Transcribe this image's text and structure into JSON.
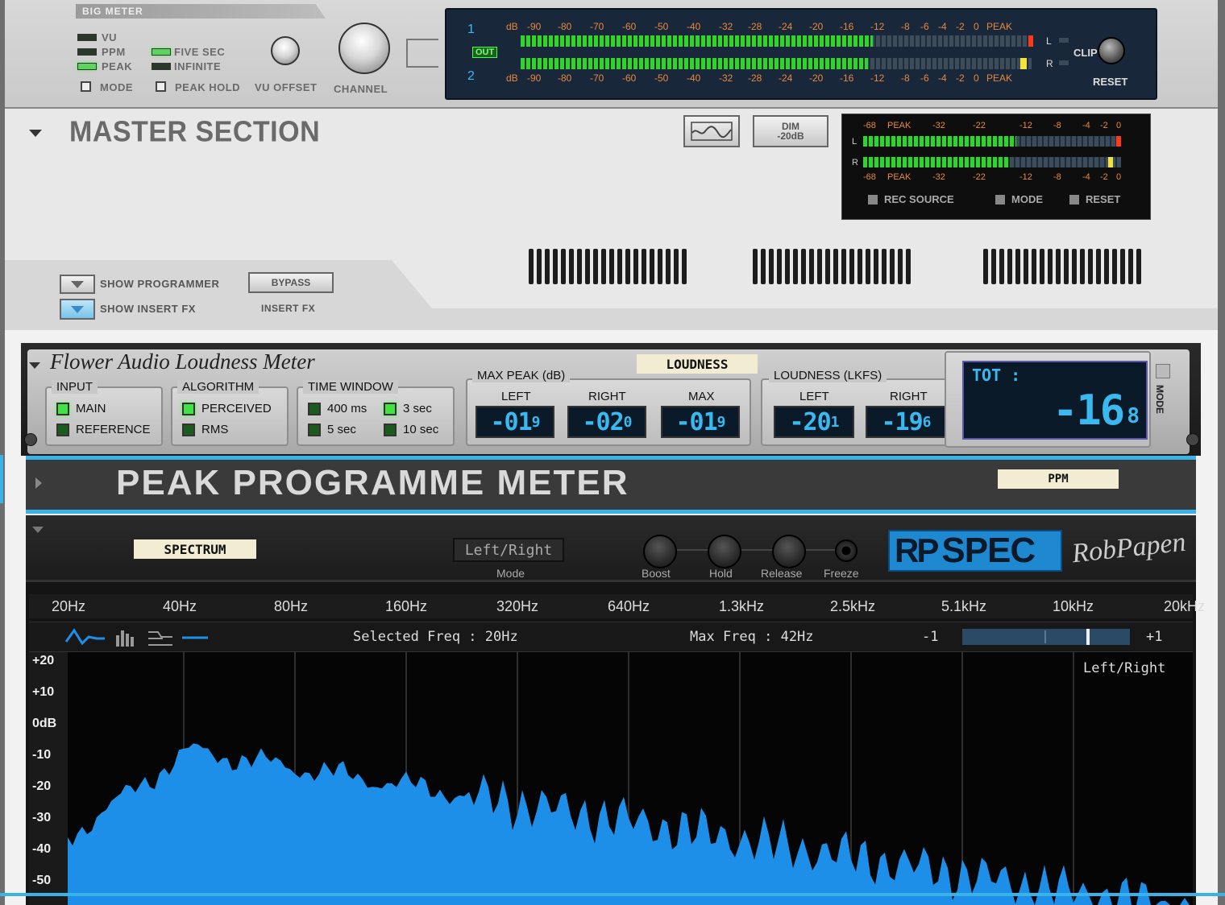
{
  "big_meter": {
    "title": "BIG METER",
    "modes": [
      "VU",
      "PPM",
      "PEAK"
    ],
    "times": [
      "FIVE SEC",
      "INFINITE"
    ],
    "mode_label": "MODE",
    "peak_hold_label": "PEAK HOLD",
    "vu_offset_label": "VU OFFSET",
    "channel_label": "CHANNEL",
    "ch1": "1",
    "ch2": "2",
    "out_label": "OUT",
    "scale": [
      "dB",
      "-90",
      "-80",
      "-70",
      "-60",
      "-50",
      "-40",
      "-32",
      "-28",
      "-24",
      "-20",
      "-16",
      "-12",
      "-8",
      "-6",
      "-4",
      "-2",
      "0",
      "PEAK"
    ],
    "l_label": "L",
    "r_label": "R",
    "clip_label": "CLIP",
    "reset_label": "RESET",
    "level_ch1": 0.69,
    "level_ch2": 0.68
  },
  "master": {
    "title": "MASTER SECTION",
    "dim_label": "DIM",
    "dim_value": "-20dB",
    "meter_scale": [
      "-68",
      "PEAK",
      "-32",
      "-22",
      "-12",
      "-8",
      "-4",
      "-2",
      "0"
    ],
    "l_label": "L",
    "r_label": "R",
    "rec_source_label": "REC SOURCE",
    "mode_label": "MODE",
    "reset_label": "RESET",
    "show_programmer": "SHOW PROGRAMMER",
    "show_insert_fx": "SHOW INSERT FX",
    "bypass_label": "BYPASS",
    "insert_fx_label": "INSERT FX"
  },
  "loudness": {
    "title": "Flower Audio Loudness Meter",
    "tape": "LOUDNESS",
    "input_title": "INPUT",
    "input_options": [
      "MAIN",
      "REFERENCE"
    ],
    "algorithm_title": "ALGORITHM",
    "algorithm_options": [
      "PERCEIVED",
      "RMS"
    ],
    "time_title": "TIME WINDOW",
    "time_options": [
      "400 ms",
      "3 sec",
      "5 sec",
      "10 sec"
    ],
    "maxpeak_title": "MAX PEAK (dB)",
    "left_label": "LEFT",
    "right_label": "RIGHT",
    "max_label": "MAX",
    "peak_left": "-01",
    "peak_left_dec": "9",
    "peak_right": "-02",
    "peak_right_dec": "0",
    "peak_max": "-01",
    "peak_max_dec": "9",
    "lkfs_title": "LOUDNESS (LKFS)",
    "lkfs_left": "-20",
    "lkfs_left_dec": "1",
    "lkfs_right": "-19",
    "lkfs_right_dec": "6",
    "tot_label": "TOT :",
    "tot_value": "-16",
    "tot_dec": "8",
    "mode_label": "MODE"
  },
  "ppm": {
    "title": "PEAK PROGRAMME METER",
    "tape": "PPM"
  },
  "spectrum": {
    "tape": "SPECTRUM",
    "mode_value": "Left/Right",
    "mode_label": "Mode",
    "knobs": [
      "Boost",
      "Hold",
      "Release",
      "Freeze"
    ],
    "logo": "SPEC",
    "logo_prefix": "RP",
    "brand": "RobPapen",
    "freq_labels": [
      "20Hz",
      "40Hz",
      "80Hz",
      "160Hz",
      "320Hz",
      "640Hz",
      "1.3kHz",
      "2.5kHz",
      "5.1kHz",
      "10kHz",
      "20kHz"
    ],
    "selected_freq": "Selected Freq : 20Hz",
    "max_freq": "Max Freq : 42Hz",
    "minus_one": "-1",
    "plus_one": "+1",
    "db_labels": [
      "+20",
      "+10",
      "0dB",
      "-10",
      "-20",
      "-30",
      "-40",
      "-50"
    ],
    "channel_label": "Left/Right",
    "accent": "#1e8fe8"
  }
}
